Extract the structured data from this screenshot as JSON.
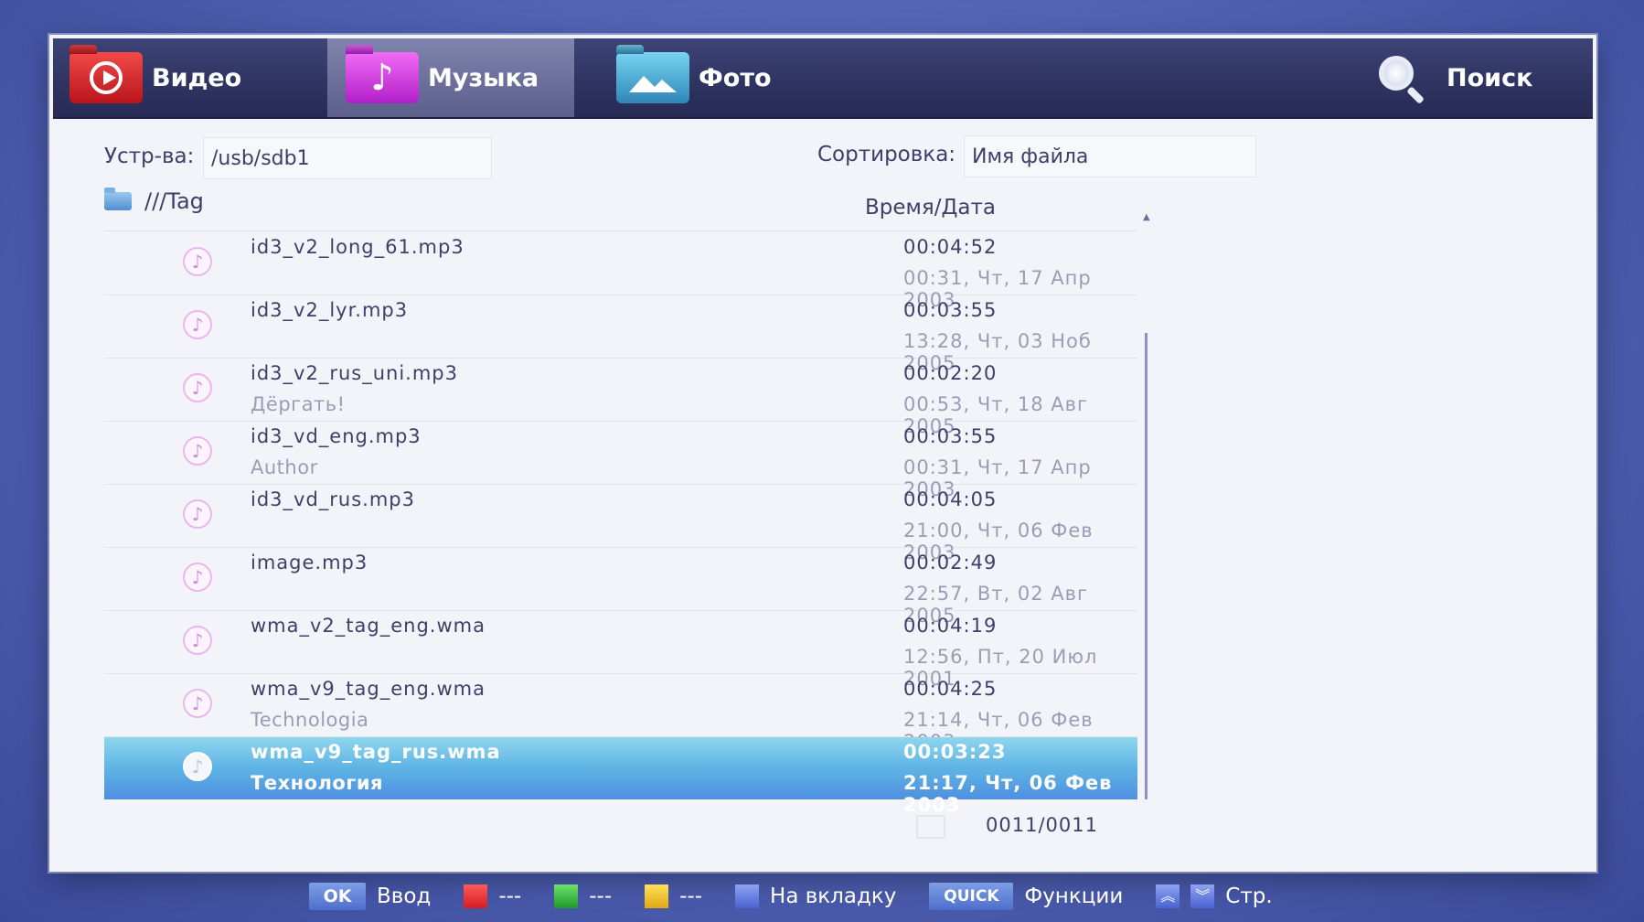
{
  "tabs": {
    "video": "Видео",
    "music": "Музыка",
    "photo": "Фото",
    "search": "Поиск"
  },
  "toolbar": {
    "device_label": "Устр-ва:",
    "device_value": "/usb/sdb1",
    "sort_label": "Сортировка:",
    "sort_value": "Имя файла"
  },
  "list_header": {
    "path": "///Tag",
    "time_date": "Время/Дата"
  },
  "files": [
    {
      "name": "id3_v2_long_61.mp3",
      "sub": "",
      "duration": "00:04:52",
      "date": "00:31, Чт, 17 Апр 2003"
    },
    {
      "name": "id3_v2_lyr.mp3",
      "sub": "",
      "duration": "00:03:55",
      "date": "13:28, Чт, 03 Ноб 2005"
    },
    {
      "name": "id3_v2_rus_uni.mp3",
      "sub": "Дёргать!",
      "duration": "00:02:20",
      "date": "00:53, Чт, 18 Авг 2005"
    },
    {
      "name": "id3_vd_eng.mp3",
      "sub": "Author",
      "duration": "00:03:55",
      "date": "00:31, Чт, 17 Апр 2003"
    },
    {
      "name": "id3_vd_rus.mp3",
      "sub": "",
      "duration": "00:04:05",
      "date": "21:00, Чт, 06 Фев 2003"
    },
    {
      "name": "image.mp3",
      "sub": "",
      "duration": "00:02:49",
      "date": "22:57, Вт, 02 Авг 2005"
    },
    {
      "name": "wma_v2_tag_eng.wma",
      "sub": "",
      "duration": "00:04:19",
      "date": "12:56, Пт, 20 Июл 2001"
    },
    {
      "name": "wma_v9_tag_eng.wma",
      "sub": "Technologia",
      "duration": "00:04:25",
      "date": "21:14, Чт, 06 Фев 2003"
    },
    {
      "name": "wma_v9_tag_rus.wma",
      "sub": "Технология",
      "duration": "00:03:23",
      "date": "21:17, Чт, 06 Фев 2003",
      "selected": true
    }
  ],
  "counter": "0011/0011",
  "footer": {
    "ok_btn": "OK",
    "ok_label": "Ввод",
    "red_label": "---",
    "green_label": "---",
    "yellow_label": "---",
    "blue_label": "На вкладку",
    "quick_btn": "QUICK",
    "quick_label": "Функции",
    "page_label": "Стр."
  },
  "icons": {
    "video": "play-circle-icon",
    "music": "music-note-icon",
    "photo": "mountain-icon",
    "search": "magnifier-icon",
    "folder": "folder-icon",
    "file": "music-note-icon"
  },
  "colors": {
    "tabbar": "#2e3360",
    "active_tab": "#6b6f9a",
    "selection": "#5eb4e4",
    "panel": "#f3f4f9"
  }
}
